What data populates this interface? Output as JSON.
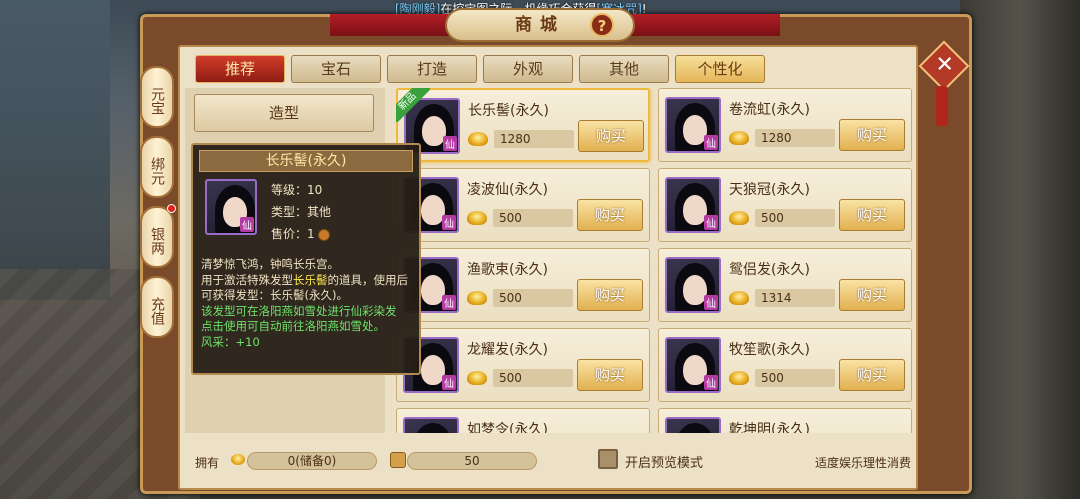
{
  "marquee": {
    "player": "[陶刚毅]",
    "text": "在挖宝图之际，机缘巧合获得",
    "item": "[寒冰咒]",
    "end": "!"
  },
  "window": {
    "title": "商城",
    "help_label": "?",
    "close_label": "✕"
  },
  "currency_tabs": [
    {
      "label": "元宝",
      "badge": false
    },
    {
      "label": "绑元",
      "badge": false
    },
    {
      "label": "银两",
      "badge": true
    },
    {
      "label": "充值",
      "badge": false
    }
  ],
  "tabs": [
    {
      "label": "推荐",
      "state": "active"
    },
    {
      "label": "宝石",
      "state": "normal"
    },
    {
      "label": "打造",
      "state": "normal"
    },
    {
      "label": "外观",
      "state": "normal"
    },
    {
      "label": "其他",
      "state": "normal"
    },
    {
      "label": "个性化",
      "state": "gold"
    }
  ],
  "subnav": {
    "label": "造型"
  },
  "items": [
    {
      "name": "长乐髻(永久)",
      "price": "1280",
      "buy": "购买",
      "new_badge": "新品",
      "selected": true
    },
    {
      "name": "卷流虹(永久)",
      "price": "1280",
      "buy": "购买",
      "new_badge": "",
      "selected": false
    },
    {
      "name": "凌波仙(永久)",
      "price": "500",
      "buy": "购买",
      "new_badge": "",
      "selected": false
    },
    {
      "name": "天狼冠(永久)",
      "price": "500",
      "buy": "购买",
      "new_badge": "",
      "selected": false
    },
    {
      "name": "渔歌束(永久)",
      "price": "500",
      "buy": "购买",
      "new_badge": "",
      "selected": false
    },
    {
      "name": "鸳侣发(永久)",
      "price": "1314",
      "buy": "购买",
      "new_badge": "",
      "selected": false
    },
    {
      "name": "龙耀发(永久)",
      "price": "500",
      "buy": "购买",
      "new_badge": "",
      "selected": false
    },
    {
      "name": "牧笙歌(永久)",
      "price": "500",
      "buy": "购买",
      "new_badge": "",
      "selected": false
    },
    {
      "name": "如梦令(永久)",
      "price": "",
      "buy": "",
      "new_badge": "",
      "selected": false
    },
    {
      "name": "乾坤明(永久)",
      "price": "",
      "buy": "",
      "new_badge": "",
      "selected": false
    }
  ],
  "avatar_tag": "仙",
  "tooltip": {
    "title": "长乐髻(永久)",
    "level": "等级：10",
    "type": "类型：其他",
    "price_label": "售价：1",
    "desc1": "清梦惊飞鸿，钟鸣长乐宫。",
    "desc2a": "用于激活特殊发型",
    "desc2b": "长乐髻",
    "desc2c": "的道具，使用后可获得发型：长乐髻(永久)。",
    "green1": "该发型可在洛阳燕如雪处进行仙彩染发",
    "green2": "点击使用可自动前往洛阳燕如雪处。",
    "fengcai": "风采：+10"
  },
  "bottom": {
    "own_label": "拥有",
    "gold_amount": "0(储备0)",
    "bound_amount": "50",
    "preview_label": "开启预览模式",
    "notice": "适度娱乐理性消费"
  }
}
